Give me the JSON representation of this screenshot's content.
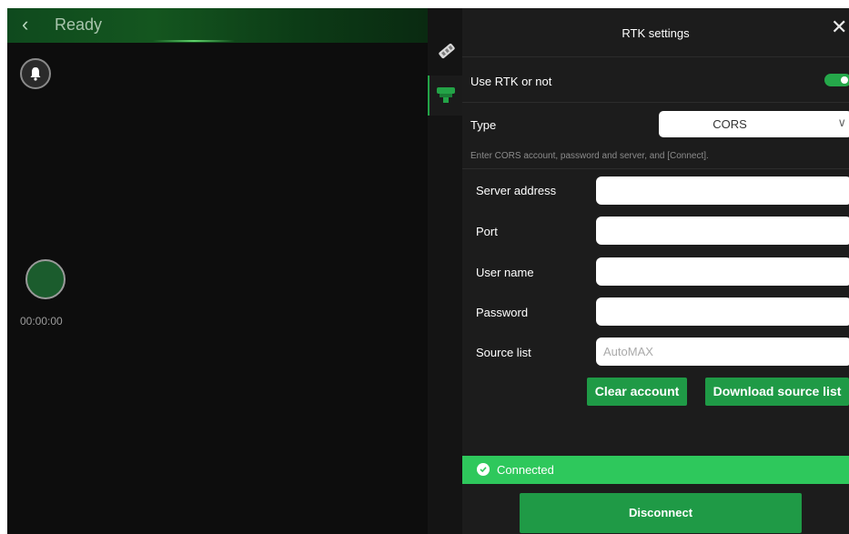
{
  "camera": {
    "status_text": "Ready",
    "timer": "00:00:00"
  },
  "panel": {
    "title": "RTK settings",
    "use_rtk_label": "Use RTK or not",
    "use_rtk_on": true,
    "type_label": "Type",
    "type_value": "CORS",
    "hint": "Enter CORS account, password and server, and [Connect].",
    "fields": {
      "server_label": "Server address",
      "server_value": "",
      "port_label": "Port",
      "port_value": "",
      "user_label": "User name",
      "user_value": "",
      "password_label": "Password",
      "password_value": "",
      "source_label": "Source list",
      "source_placeholder": "AutoMAX"
    },
    "clear_label": "Clear account",
    "download_label": "Download source list",
    "status_text": "Connected",
    "disconnect_label": "Disconnect"
  },
  "colors": {
    "accent": "#1f9a46",
    "status_green": "#2ec85c",
    "panel_bg": "#1c1c1c"
  },
  "icons": [
    "back-chevron-icon",
    "bell-icon",
    "record-button",
    "wrench-icon",
    "rtk-antenna-icon",
    "close-icon",
    "chevron-down-icon",
    "check-circle-icon"
  ]
}
